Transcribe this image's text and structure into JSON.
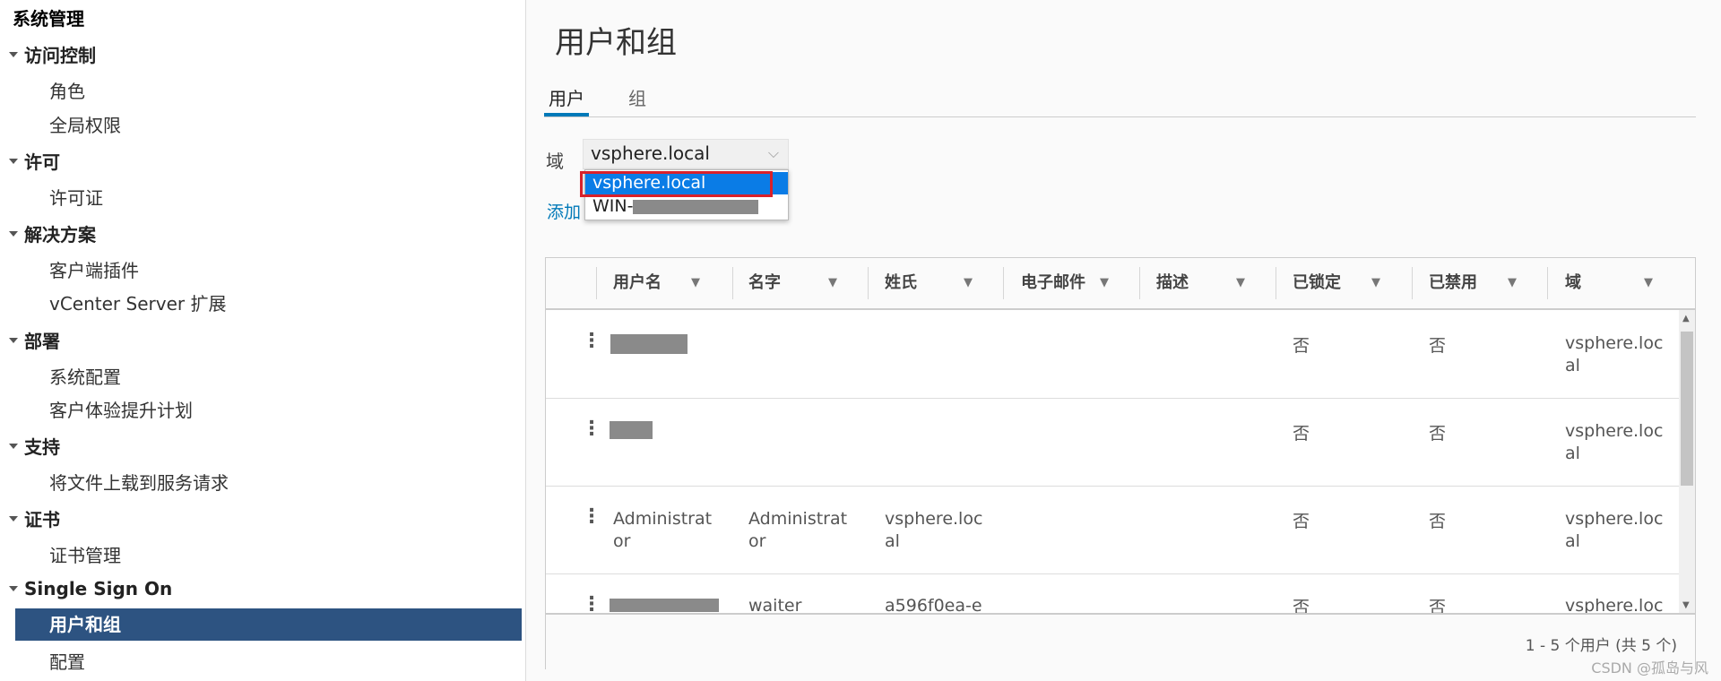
{
  "sidebar": {
    "title": "系统管理",
    "sections": [
      {
        "label": "访问控制",
        "items": [
          "角色",
          "全局权限"
        ]
      },
      {
        "label": "许可",
        "items": [
          "许可证"
        ]
      },
      {
        "label": "解决方案",
        "items": [
          "客户端插件",
          "vCenter Server 扩展"
        ]
      },
      {
        "label": "部署",
        "items": [
          "系统配置",
          "客户体验提升计划"
        ]
      },
      {
        "label": "支持",
        "items": [
          "将文件上载到服务请求"
        ]
      },
      {
        "label": "证书",
        "items": [
          "证书管理"
        ]
      },
      {
        "label": "Single Sign On",
        "items": [
          "用户和组",
          "配置"
        ]
      }
    ],
    "active_item": "用户和组"
  },
  "main": {
    "title": "用户和组",
    "tabs": [
      {
        "label": "用户",
        "active": true
      },
      {
        "label": "组",
        "active": false
      }
    ],
    "domain_label": "域",
    "domain_selected": "vsphere.local",
    "domain_options": [
      "vsphere.local",
      "WIN-"
    ],
    "add_link": "添加",
    "table": {
      "columns": [
        "用户名",
        "名字",
        "姓氏",
        "电子邮件",
        "描述",
        "已锁定",
        "已禁用",
        "域"
      ],
      "rows": [
        {
          "username": "",
          "first": "",
          "last": "",
          "email": "",
          "desc": "",
          "locked": "否",
          "disabled": "否",
          "domain": "vsphere.loc\nal"
        },
        {
          "username": "",
          "first": "",
          "last": "",
          "email": "",
          "desc": "",
          "locked": "否",
          "disabled": "否",
          "domain": "vsphere.loc\nal"
        },
        {
          "username": "Administrat\nor",
          "first": "Administrat\nor",
          "last": "vsphere.loc\nal",
          "email": "",
          "desc": "",
          "locked": "否",
          "disabled": "否",
          "domain": "vsphere.loc\nal"
        },
        {
          "username": "",
          "first": "waiter",
          "last": "a596f0ea-e",
          "email": "",
          "desc": "",
          "locked": "否",
          "disabled": "否",
          "domain": "vsphere.loc"
        }
      ],
      "footer": "1 - 5 个用户 (共 5 个)"
    }
  },
  "watermark": "CSDN @孤岛与风",
  "colors": {
    "accent": "#0079b8",
    "active_nav": "#2d5381",
    "selected_option": "#0a7ce6",
    "highlight_border": "#d9212a"
  }
}
